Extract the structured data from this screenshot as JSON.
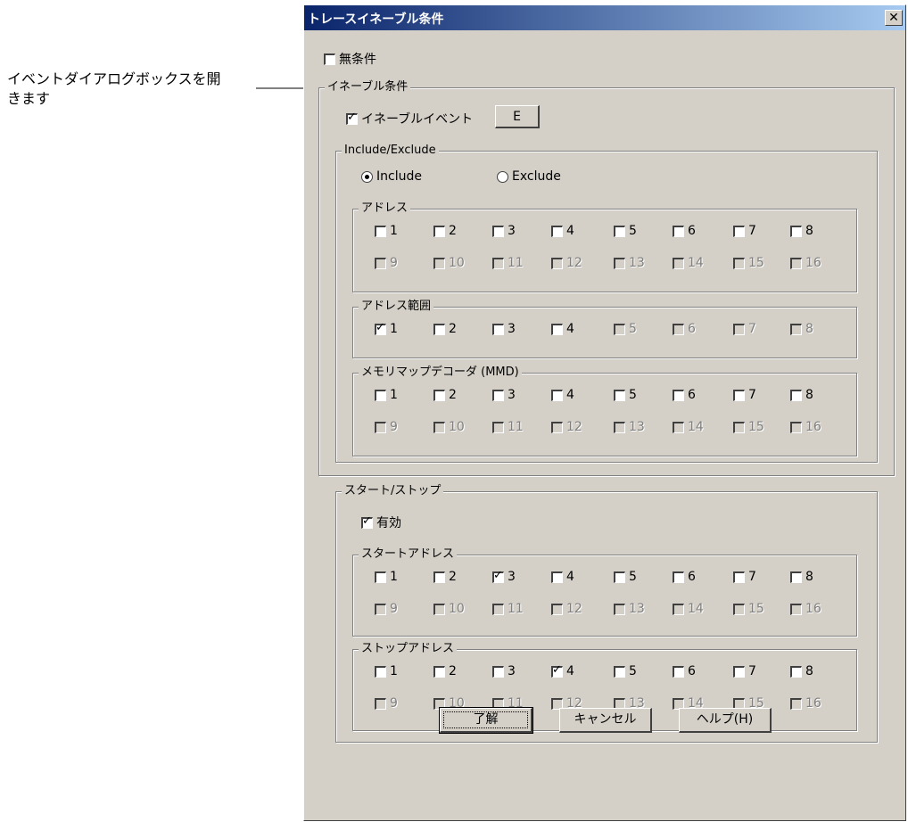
{
  "annotation": {
    "text": "イベントダイアログボックスを開きます"
  },
  "dialog": {
    "title": "トレースイネーブル条件",
    "close_glyph": "✕",
    "unconditional": {
      "label": "無条件",
      "checked": false
    },
    "enable_group": {
      "legend": "イネーブル条件",
      "enable_event": {
        "label": "イネーブルイベント",
        "checked": true
      },
      "event_button": "E",
      "include_exclude": {
        "legend": "Include/Exclude",
        "include_label": "Include",
        "exclude_label": "Exclude",
        "selected": "Include"
      },
      "address": {
        "legend": "アドレス",
        "row1": [
          {
            "label": "1",
            "checked": false
          },
          {
            "label": "2",
            "checked": false
          },
          {
            "label": "3",
            "checked": false
          },
          {
            "label": "4",
            "checked": false
          },
          {
            "label": "5",
            "checked": false
          },
          {
            "label": "6",
            "checked": false
          },
          {
            "label": "7",
            "checked": false
          },
          {
            "label": "8",
            "checked": false
          }
        ],
        "row2": [
          "9",
          "10",
          "11",
          "12",
          "13",
          "14",
          "15",
          "16"
        ]
      },
      "address_range": {
        "legend": "アドレス範囲",
        "enabled": [
          {
            "label": "1",
            "checked": true
          },
          {
            "label": "2",
            "checked": false
          },
          {
            "label": "3",
            "checked": false
          },
          {
            "label": "4",
            "checked": false
          }
        ],
        "disabled": [
          "5",
          "6",
          "7",
          "8"
        ]
      },
      "mmd": {
        "legend": "メモリマップデコーダ (MMD)",
        "row1": [
          {
            "label": "1",
            "checked": false
          },
          {
            "label": "2",
            "checked": false
          },
          {
            "label": "3",
            "checked": false
          },
          {
            "label": "4",
            "checked": false
          },
          {
            "label": "5",
            "checked": false
          },
          {
            "label": "6",
            "checked": false
          },
          {
            "label": "7",
            "checked": false
          },
          {
            "label": "8",
            "checked": false
          }
        ],
        "row2": [
          "9",
          "10",
          "11",
          "12",
          "13",
          "14",
          "15",
          "16"
        ]
      }
    },
    "start_stop": {
      "legend": "スタート/ストップ",
      "valid": {
        "label": "有効",
        "checked": true
      },
      "start_address": {
        "legend": "スタートアドレス",
        "row1": [
          {
            "label": "1",
            "checked": false
          },
          {
            "label": "2",
            "checked": false
          },
          {
            "label": "3",
            "checked": true
          },
          {
            "label": "4",
            "checked": false
          },
          {
            "label": "5",
            "checked": false
          },
          {
            "label": "6",
            "checked": false
          },
          {
            "label": "7",
            "checked": false
          },
          {
            "label": "8",
            "checked": false
          }
        ],
        "row2": [
          "9",
          "10",
          "11",
          "12",
          "13",
          "14",
          "15",
          "16"
        ]
      },
      "stop_address": {
        "legend": "ストップアドレス",
        "row1": [
          {
            "label": "1",
            "checked": false
          },
          {
            "label": "2",
            "checked": false
          },
          {
            "label": "3",
            "checked": false
          },
          {
            "label": "4",
            "checked": true
          },
          {
            "label": "5",
            "checked": false
          },
          {
            "label": "6",
            "checked": false
          },
          {
            "label": "7",
            "checked": false
          },
          {
            "label": "8",
            "checked": false
          }
        ],
        "row2": [
          "9",
          "10",
          "11",
          "12",
          "13",
          "14",
          "15",
          "16"
        ]
      }
    },
    "buttons": {
      "ok": "了解",
      "cancel": "キャンセル",
      "help": "ヘルプ(H)"
    }
  }
}
